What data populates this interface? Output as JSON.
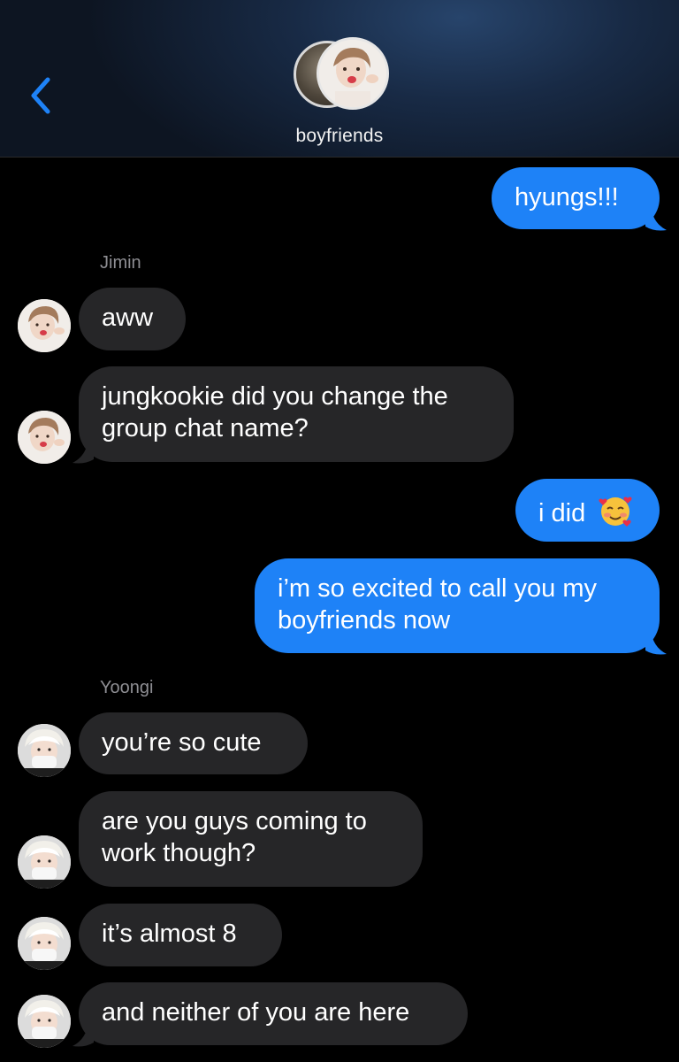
{
  "header": {
    "group_name": "boyfriends"
  },
  "messages": [
    {
      "id": 1,
      "direction": "out",
      "text": "hyungs!!!"
    },
    {
      "id": 2,
      "sender": "Jimin"
    },
    {
      "id": 3,
      "direction": "in",
      "text": "aww"
    },
    {
      "id": 4,
      "direction": "in",
      "lines": [
        "jungkookie did you change the",
        "group chat name?"
      ]
    },
    {
      "id": 5,
      "direction": "out",
      "text": "i did"
    },
    {
      "id": 6,
      "direction": "out",
      "lines": [
        "i’m so excited to call you my",
        "boyfriends now"
      ]
    },
    {
      "id": 7,
      "sender": "Yoongi"
    },
    {
      "id": 8,
      "direction": "in",
      "text": "you’re so cute"
    },
    {
      "id": 9,
      "direction": "in",
      "lines": [
        "are you guys coming to",
        "work though?"
      ]
    },
    {
      "id": 10,
      "direction": "in",
      "text": "it’s almost 8"
    },
    {
      "id": 11,
      "direction": "in",
      "text": "and neither of you are here"
    }
  ],
  "icons": {
    "back": "chevron-left-icon",
    "smiling_hearts": "smiling-face-with-hearts-emoji"
  },
  "colors": {
    "outgoing_bubble": "#1e82f7",
    "incoming_bubble": "#262628",
    "accent": "#1e82f7",
    "sender_label": "#8e8e93"
  }
}
